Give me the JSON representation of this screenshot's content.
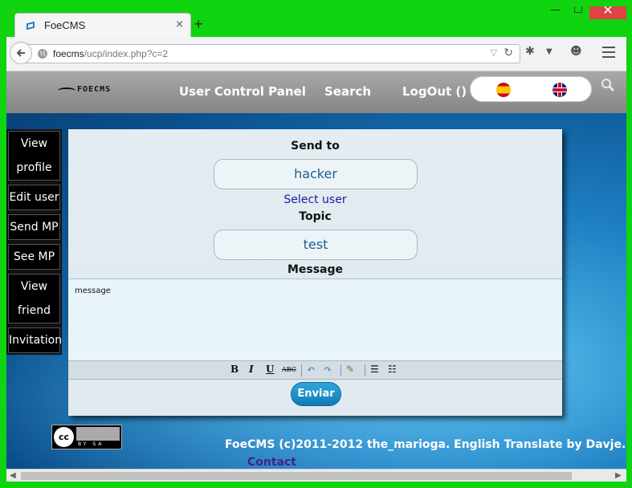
{
  "browser": {
    "tab_title": "FoeCMS",
    "tab_close": "×",
    "new_tab": "+",
    "url_host": "foecms",
    "url_path": "/ucp/index.php?c=2",
    "window_buttons": [
      "—",
      "☐",
      "✕"
    ]
  },
  "site": {
    "logo": "FOECMS",
    "nav": [
      "User Control Panel",
      "Search",
      "LogOut ()"
    ]
  },
  "sidebar": {
    "items": [
      {
        "label_1": "View",
        "label_2": "profile"
      },
      {
        "label_1": "Edit user"
      },
      {
        "label_1": "Send MP"
      },
      {
        "label_1": "See MP"
      },
      {
        "label_1": "View",
        "label_2": "friend"
      },
      {
        "label_1": "Invitation"
      }
    ]
  },
  "form": {
    "send_to_label": "Send to",
    "send_to_value": "hacker",
    "select_user": "Select user",
    "topic_label": "Topic",
    "topic_value": "test",
    "message_label": "Message",
    "message_value": "message",
    "submit": "Enviar"
  },
  "footer": {
    "cc_text": "BY SA",
    "credit": "FoeCMS (c)2011-2012 the_marioga. English Translate by Davje.",
    "contact": "Contact"
  }
}
